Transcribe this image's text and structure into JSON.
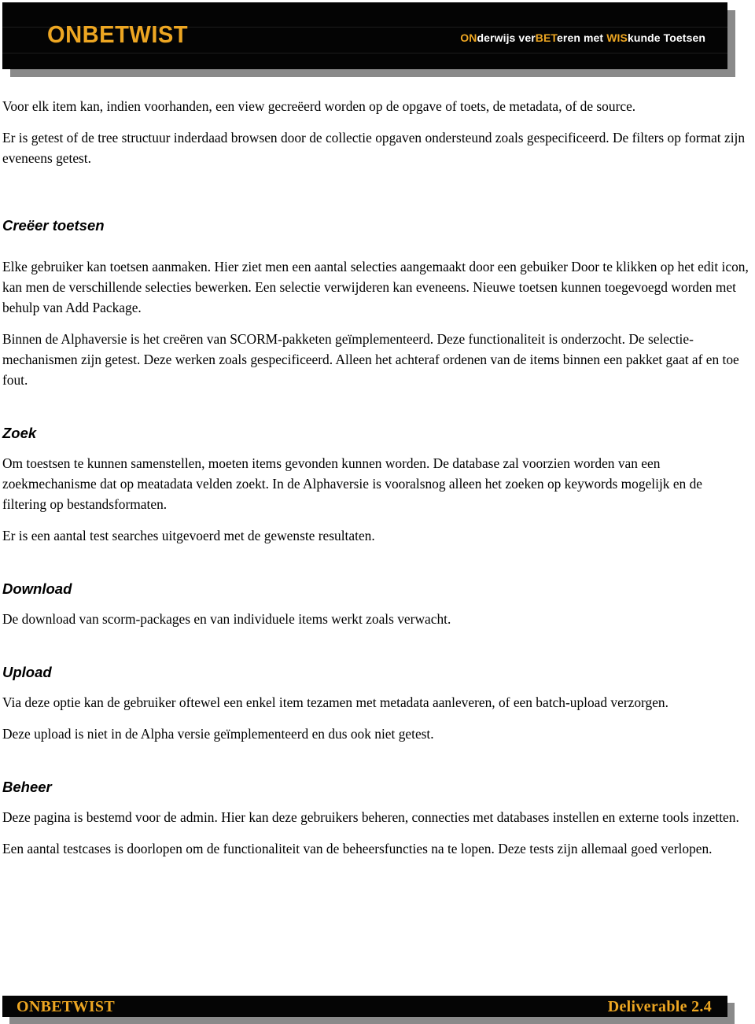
{
  "document": {
    "title": "ONBETWIST Deliverable 2.4",
    "colors": {
      "accent_gold": "#eda622",
      "banner_black": "#040404",
      "shadow_gray": "#8a8a8a",
      "body_text": "#000000",
      "tagline_white": "#ffffff"
    }
  },
  "header": {
    "brand": "ONBETWIST",
    "tagline": {
      "part1_highlight": "ON",
      "part1_plain": "derwijs ver",
      "part2_highlight": "BET",
      "part2_plain": "eren met ",
      "part3_highlight": "WIS",
      "part3_plain": "kunde Toetsen",
      "full_text": "ONderwijs verBETeren met WISkunde Toetsen"
    }
  },
  "body": {
    "intro_paragraphs": [
      "Voor elk item kan, indien voorhanden, een view gecreëerd worden op de opgave of toets, de metadata, of de source.",
      "Er is getest of de tree structuur inderdaad browsen door de collectie opgaven ondersteund zoals gespecificeerd. De filters op format zijn eveneens getest."
    ],
    "sections": [
      {
        "heading": "Creëer toetsen",
        "paragraphs": [
          "Elke gebruiker kan toetsen aanmaken. Hier ziet men een aantal selecties aangemaakt door een gebuiker Door te klikken op het edit icon, kan men de verschillende selecties bewerken. Een selectie verwijderen kan eveneens. Nieuwe toetsen kunnen toegevoegd worden met behulp van Add Package.",
          "Binnen de Alphaversie is het creëren van SCORM-pakketen geïmplementeerd. Deze functionaliteit is onderzocht. De selectie-mechanismen zijn getest. Deze werken zoals gespecificeerd. Alleen het achteraf ordenen van de items binnen een pakket gaat af en toe fout."
        ]
      },
      {
        "heading": "Zoek",
        "paragraphs": [
          "Om toestsen te kunnen samenstellen, moeten items gevonden kunnen worden. De database zal voorzien worden van een zoekmechanisme dat op meatadata velden zoekt. In de Alphaversie is vooralsnog alleen het zoeken op keywords mogelijk en de filtering op bestandsformaten.",
          "Er is een aantal test searches uitgevoerd met de gewenste resultaten."
        ]
      },
      {
        "heading": "Download",
        "paragraphs": [
          "De download van scorm-packages en van individuele items werkt zoals verwacht."
        ]
      },
      {
        "heading": "Upload",
        "paragraphs": [
          "Via deze optie kan de gebruiker oftewel een enkel item tezamen met metadata aanleveren, of een batch-upload verzorgen.",
          "Deze upload is niet in de Alpha versie geïmplementeerd en dus ook niet getest."
        ]
      },
      {
        "heading": "Beheer",
        "paragraphs": [
          "Deze pagina is bestemd voor de admin. Hier kan deze gebruikers beheren, connecties met databases instellen en externe tools inzetten.",
          "Een aantal testcases is doorlopen om de functionaliteit van de beheersfuncties na te lopen. Deze tests zijn allemaal goed verlopen."
        ]
      }
    ]
  },
  "footer": {
    "left": "ONBETWIST",
    "right": "Deliverable 2.4"
  }
}
